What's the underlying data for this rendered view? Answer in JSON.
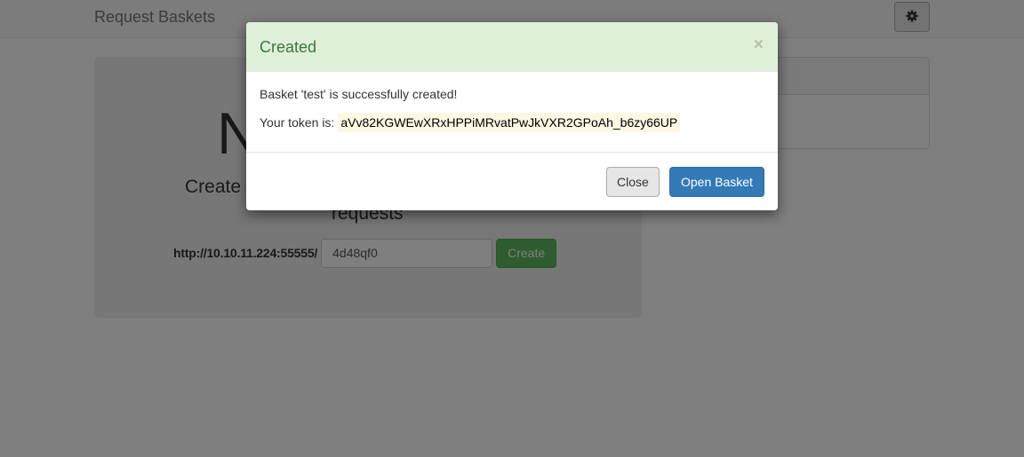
{
  "navbar": {
    "brand": "Request Baskets",
    "settings_icon": "gear-icon"
  },
  "jumbotron": {
    "heading": "N",
    "lead": "Create                                                     requests",
    "url_prefix": "http://10.10.11.224:55555/",
    "basket_name_value": "4d48qf0",
    "create_label": "Create"
  },
  "modal": {
    "title": "Created",
    "close_symbol": "×",
    "message": "Basket 'test' is successfully created!",
    "token_label": "Your token is:",
    "token": "aVv82KGWEwXRxHPPiMRvatPwJkVXR2GPoAh_b6zy66UP",
    "close_label": "Close",
    "open_label": "Open Basket"
  },
  "colors": {
    "modal_header_bg": "#dff0d8",
    "modal_title": "#3c763d",
    "primary": "#337ab7",
    "success": "#5cb85c",
    "token_highlight": "#fcf8e3"
  }
}
